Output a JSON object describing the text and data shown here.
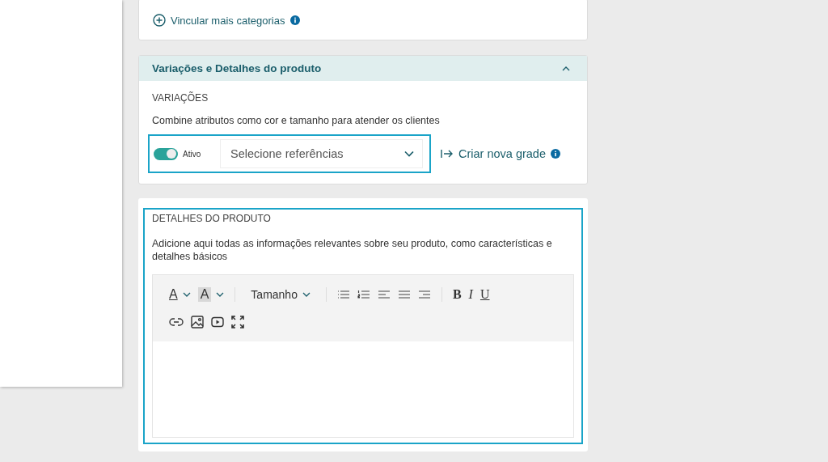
{
  "categories": {
    "link": "Vincular mais categorias"
  },
  "section": {
    "title": "Variações e Detalhes do produto",
    "expanded": true
  },
  "variations": {
    "heading": "VARIAÇÕES",
    "description": "Combine atributos como cor e tamanho para atender os clientes",
    "toggle": {
      "label": "Ativo",
      "on": true
    },
    "select": {
      "placeholder": "Selecione referências"
    },
    "link": "Criar nova grade"
  },
  "details": {
    "heading": "DETALHES DO PRODUTO",
    "description": "Adicione aqui todas as informações relevantes sobre seu produto, como características e detalhes básicos",
    "toolbar": [
      {
        "kind": "color",
        "label": "A"
      },
      {
        "kind": "highlight",
        "label": "A"
      },
      {
        "kind": "separator"
      },
      {
        "kind": "size",
        "label": "Tamanho"
      },
      {
        "kind": "separator"
      },
      {
        "kind": "bullets"
      },
      {
        "kind": "numbers"
      },
      {
        "kind": "align-left"
      },
      {
        "kind": "justify"
      },
      {
        "kind": "align-right"
      },
      {
        "kind": "separator"
      },
      {
        "kind": "bold",
        "label": "B"
      },
      {
        "kind": "italic",
        "label": "I"
      },
      {
        "kind": "underline",
        "label": "U"
      },
      {
        "kind": "break"
      },
      {
        "kind": "link"
      },
      {
        "kind": "image"
      },
      {
        "kind": "video"
      },
      {
        "kind": "fullscreen"
      }
    ]
  }
}
